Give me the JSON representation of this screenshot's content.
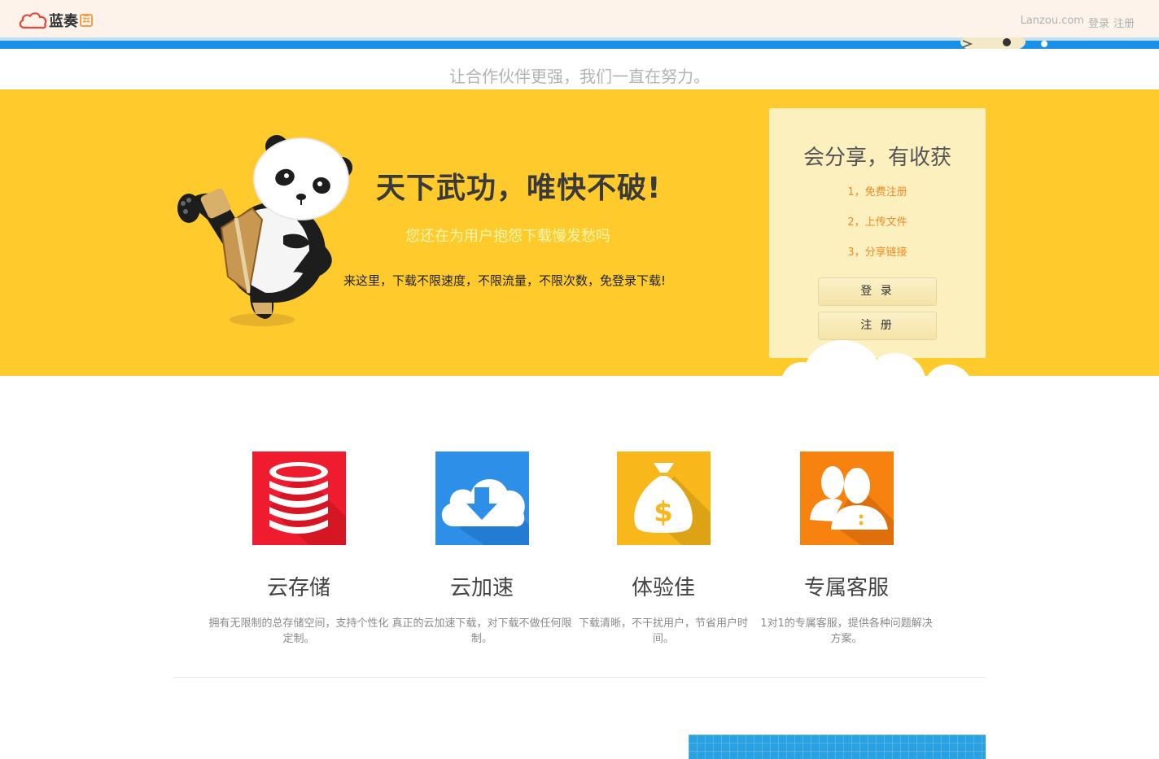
{
  "header": {
    "logo_text": "蓝奏",
    "logo_badge": "云",
    "site": "Lanzou.com",
    "login": "登录",
    "register": "注册"
  },
  "tagline": "让合作伙伴更强，我们一直在努力。",
  "hero": {
    "title": "天下武功，唯快不破!",
    "subtitle": "您还在为用户抱怨下载慢发愁吗",
    "description": "来这里，下载不限速度，不限流量，不限次数，免登录下载!"
  },
  "register_box": {
    "title": "会分享，有收获",
    "steps": [
      "1，免费注册",
      "2，上传文件",
      "3，分享链接"
    ],
    "login_button": "登 录",
    "register_button": "注 册"
  },
  "features": [
    {
      "icon": "database-icon",
      "color": "#ee1c2e",
      "title": "云存储",
      "desc": "拥有无限制的总存储空间，支持个性化定制。"
    },
    {
      "icon": "cloud-download-icon",
      "color": "#2d8fe8",
      "title": "云加速",
      "desc": "真正的云加速下载，对下载不做任何限制。"
    },
    {
      "icon": "money-bag-icon",
      "color": "#f8b81c",
      "title": "体验佳",
      "desc": "下载清晰，不干扰用户，节省用户时间。"
    },
    {
      "icon": "users-icon",
      "color": "#f8820f",
      "title": "专属客服",
      "desc": "1对1的专属客服，提供各种问题解决方案。"
    }
  ]
}
